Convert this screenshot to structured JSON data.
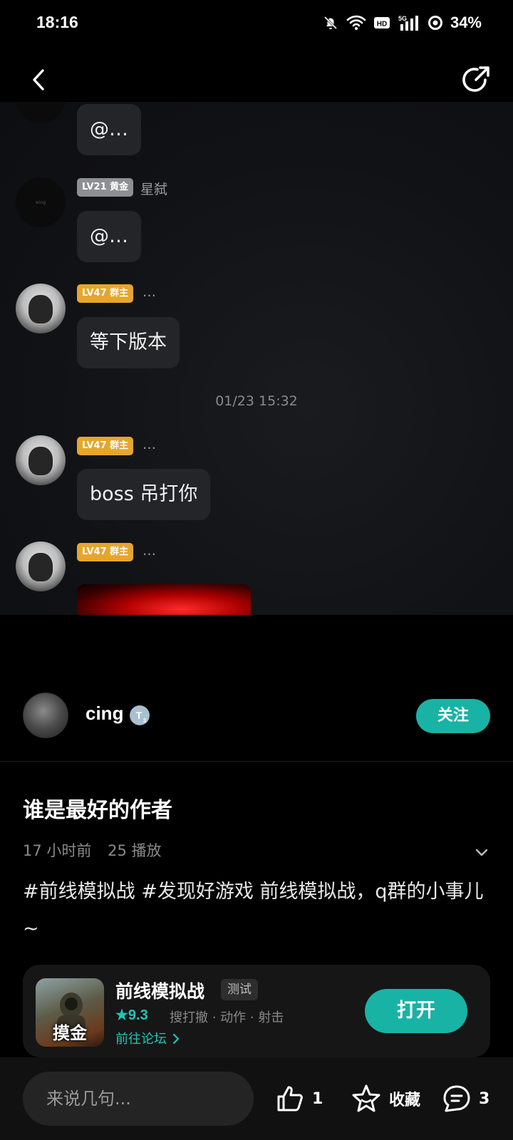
{
  "status_bar": {
    "time": "18:16",
    "battery": "34%",
    "icons": [
      "bell-muted-icon",
      "wifi-icon",
      "hd-icon",
      "5g-signal-icon",
      "ring-icon"
    ]
  },
  "nav": {
    "back_icon": "chevron-left-icon",
    "share_icon": "share-icon"
  },
  "video": {
    "messages": [
      {
        "badge": "",
        "name": "",
        "text": "@…"
      },
      {
        "badge": "LV21 黄金",
        "name": "星弑",
        "text": "@…"
      },
      {
        "badge": "LV47 群主",
        "name": "…",
        "text": "等下版本"
      },
      {
        "badge": "LV47 群主",
        "name": "…",
        "text": "boss 吊打你"
      },
      {
        "badge": "LV47 群主",
        "name": "…",
        "text": ""
      }
    ],
    "timestamp": "01/23 15:32",
    "avatar_dark_text": "wing"
  },
  "author": {
    "name": "cing",
    "follow_label": "关注"
  },
  "post": {
    "title": "谁是最好的作者",
    "time_ago": "17 小时前",
    "plays": "25 播放",
    "description": "#前线模拟战 #发现好游戏 前线模拟战，q群的小事儿~"
  },
  "game": {
    "name": "前线模拟战",
    "tag": "测试",
    "rating": "★9.3",
    "genres": "搜打撤 · 动作 · 射击",
    "forum_link": "前往论坛",
    "icon_text": "摸金",
    "open_label": "打开"
  },
  "bottom": {
    "comment_placeholder": "来说几句...",
    "likes": "1",
    "favorite_label": "收藏",
    "comments": "3"
  },
  "colors": {
    "accent": "#18b3a5",
    "badge_gold": "#e6a62b",
    "badge_gray": "#8e8f93"
  }
}
